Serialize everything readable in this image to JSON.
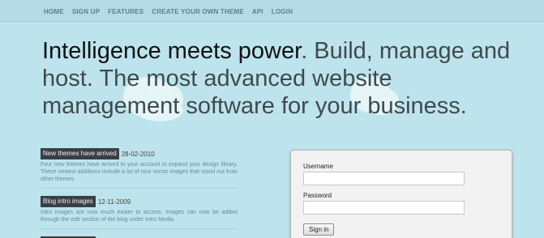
{
  "nav": {
    "items": [
      "HOME",
      "SIGN UP",
      "FEATURES",
      "CREATE YOUR OWN THEME",
      "API",
      "LOGIN"
    ]
  },
  "hero": {
    "strong": "Intelligence meets power",
    "rest": ". Build, manage and host. The most advanced website management software for your business."
  },
  "news": [
    {
      "title": "New themes have arrived",
      "date": "28-02-2010",
      "body": "Four new themes have arrived to your account to expand your design library. These newest additions include a lot of nice vector images that stand out from other themes."
    },
    {
      "title": "Blog intro images",
      "date": "12-11-2009",
      "body": "Intro images are now much easier to access. Images can now be added through the edit section of the blog under Intro Media"
    }
  ],
  "login": {
    "username_label": "Username",
    "username_value": "",
    "password_label": "Password",
    "password_value": "",
    "submit_label": "Sign in"
  },
  "colors": {
    "background": "#bde4ed",
    "nav_background": "#b5dbe5",
    "news_tag": "#3a3f41"
  }
}
